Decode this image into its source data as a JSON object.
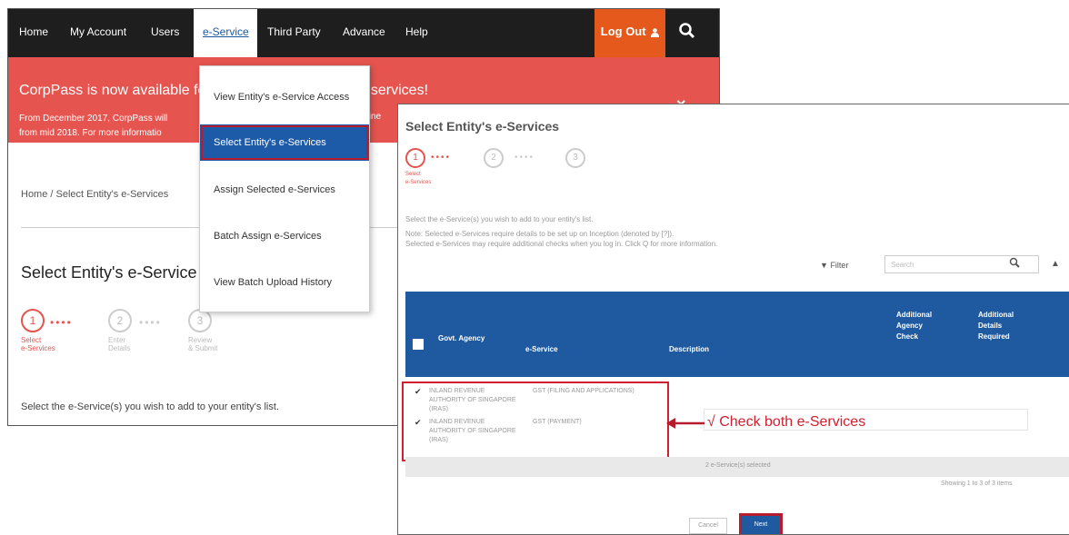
{
  "nav": {
    "items": [
      {
        "label": "Home"
      },
      {
        "label": "My Account"
      },
      {
        "label": "Users"
      },
      {
        "label": "e-Service"
      },
      {
        "label": "Third Party"
      },
      {
        "label": "Advance"
      },
      {
        "label": "Help"
      }
    ],
    "logout_label": "Log Out",
    "logout_icon": "person-icon",
    "search_icon": "search-icon"
  },
  "banner": {
    "title_left": "CorpPass is now available fo",
    "title_right": "ital services!",
    "text_left": "From December 2017, CorpPass will\nfrom mid 2018. For more informatio",
    "text_right": "B online",
    "close": "×"
  },
  "dropdown": {
    "items": [
      {
        "label": "View Entity's e-Service Access"
      },
      {
        "label": "Select Entity's e-Services"
      },
      {
        "label": "Assign Selected e-Services"
      },
      {
        "label": "Batch Assign e-Services"
      },
      {
        "label": "View Batch Upload History"
      }
    ],
    "selected_index": 1
  },
  "back": {
    "breadcrumb": "Home  /  Select Entity's e-Services",
    "page_title": "Select Entity's e-Service",
    "steps": [
      {
        "num": "1",
        "label": "Select\ne-Services"
      },
      {
        "num": "2",
        "label": "Enter\nDetails"
      },
      {
        "num": "3",
        "label": "Review\n& Submit"
      }
    ],
    "dots": "••••",
    "instruction": "Select the e-Service(s) you wish to add to your entity's list."
  },
  "front": {
    "title": "Select Entity's e-Services",
    "instruction": "Select the e-Service(s) you wish to add to your entity's list.",
    "note1": "Note: Selected e-Services require details to be set up on Inception (denoted by [?]).",
    "note2": "Selected e-Services may require additional checks when you log in. Click Q for more information.",
    "filter_label": "Filter",
    "search_placeholder": "Search",
    "table": {
      "headers": [
        "Govt. Agency",
        "e-Service",
        "Description",
        "Additional Agency Check",
        "Additional Details Required"
      ]
    },
    "rows": [
      {
        "agency": "INLAND REVENUE AUTHORITY OF SINGAPORE (IRAS)",
        "eservice": "GST (FILING AND APPLICATIONS)"
      },
      {
        "agency": "INLAND REVENUE AUTHORITY OF SINGAPORE (IRAS)",
        "eservice": "GST (PAYMENT)"
      }
    ],
    "selected_count": "2 e-Service(s) selected",
    "showing": "Showing 1 to 3 of 3 items",
    "cancel_label": "Cancel",
    "next_label": "Next"
  },
  "annotation": {
    "text": "√ Check both e-Services",
    "color": "#d02030"
  },
  "colors": {
    "brand_red": "#e5544f",
    "brand_blue": "#1f5aa0",
    "logout_orange": "#e6591c",
    "highlight": "#b71c2e"
  }
}
